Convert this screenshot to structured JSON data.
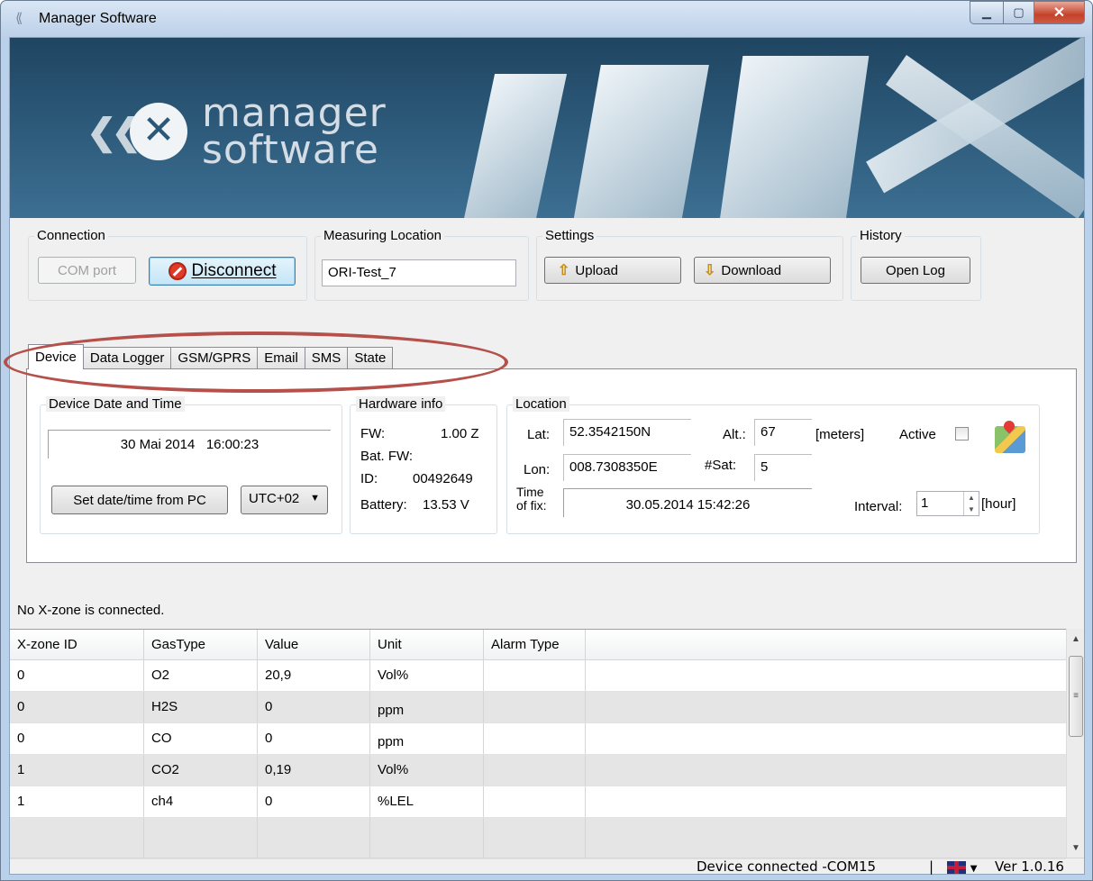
{
  "window": {
    "title": "Manager Software"
  },
  "banner": {
    "logo_line1": "manager",
    "logo_line2": "software"
  },
  "connection": {
    "legend": "Connection",
    "com_port_label": "COM port",
    "disconnect_label": "Disconnect"
  },
  "measuring_location": {
    "legend": "Measuring Location",
    "value": "ORI-Test_7"
  },
  "settings": {
    "legend": "Settings",
    "upload_label": "Upload",
    "download_label": "Download"
  },
  "history": {
    "legend": "History",
    "open_log_label": "Open Log"
  },
  "tabs": [
    {
      "label": "Device",
      "active": true
    },
    {
      "label": "Data Logger"
    },
    {
      "label": "GSM/GPRS"
    },
    {
      "label": "Email"
    },
    {
      "label": "SMS"
    },
    {
      "label": "State"
    }
  ],
  "device_datetime": {
    "legend": "Device Date and Time",
    "value": "30 Mai 2014   16:00:23",
    "set_button": "Set date/time from PC",
    "timezone": "UTC+02"
  },
  "hardware_info": {
    "legend": "Hardware info",
    "fw_label": "FW:",
    "fw_value": "1.00 Z",
    "bat_fw_label": "Bat. FW:",
    "id_label": "ID:",
    "id_value": "00492649",
    "battery_label": "Battery:",
    "battery_value": "13.53 V"
  },
  "location": {
    "legend": "Location",
    "lat_label": "Lat:",
    "lat_value": "52.3542150N",
    "lon_label": "Lon:",
    "lon_value": "008.7308350E",
    "alt_label": "Alt.:",
    "alt_value": "67",
    "alt_unit": "[meters]",
    "sat_label": "#Sat:",
    "sat_value": "5",
    "active_label": "Active",
    "time_of_fix_label1": "Time",
    "time_of_fix_label2": "of fix:",
    "time_of_fix_value": "30.05.2014 15:42:26",
    "interval_label": "Interval:",
    "interval_value": "1",
    "interval_unit": "[hour]"
  },
  "xzone_status": "No X-zone is connected.",
  "table": {
    "columns": [
      "X-zone ID",
      "GasType",
      "Value",
      "Unit",
      "Alarm Type"
    ],
    "rows": [
      [
        "0",
        "O2",
        "20,9",
        "Vol%",
        ""
      ],
      [
        "0",
        "H2S",
        "0",
        "ppm",
        ""
      ],
      [
        "0",
        "CO",
        "0",
        "ppm",
        ""
      ],
      [
        "1",
        "CO2",
        "0,19",
        "Vol%",
        ""
      ],
      [
        "1",
        "ch4",
        "0",
        "%LEL",
        ""
      ],
      [
        "",
        "",
        "",
        "",
        ""
      ]
    ]
  },
  "statusbar": {
    "connection": "Device connected -COM15",
    "separator": "|",
    "version": "Ver 1.0.16"
  }
}
